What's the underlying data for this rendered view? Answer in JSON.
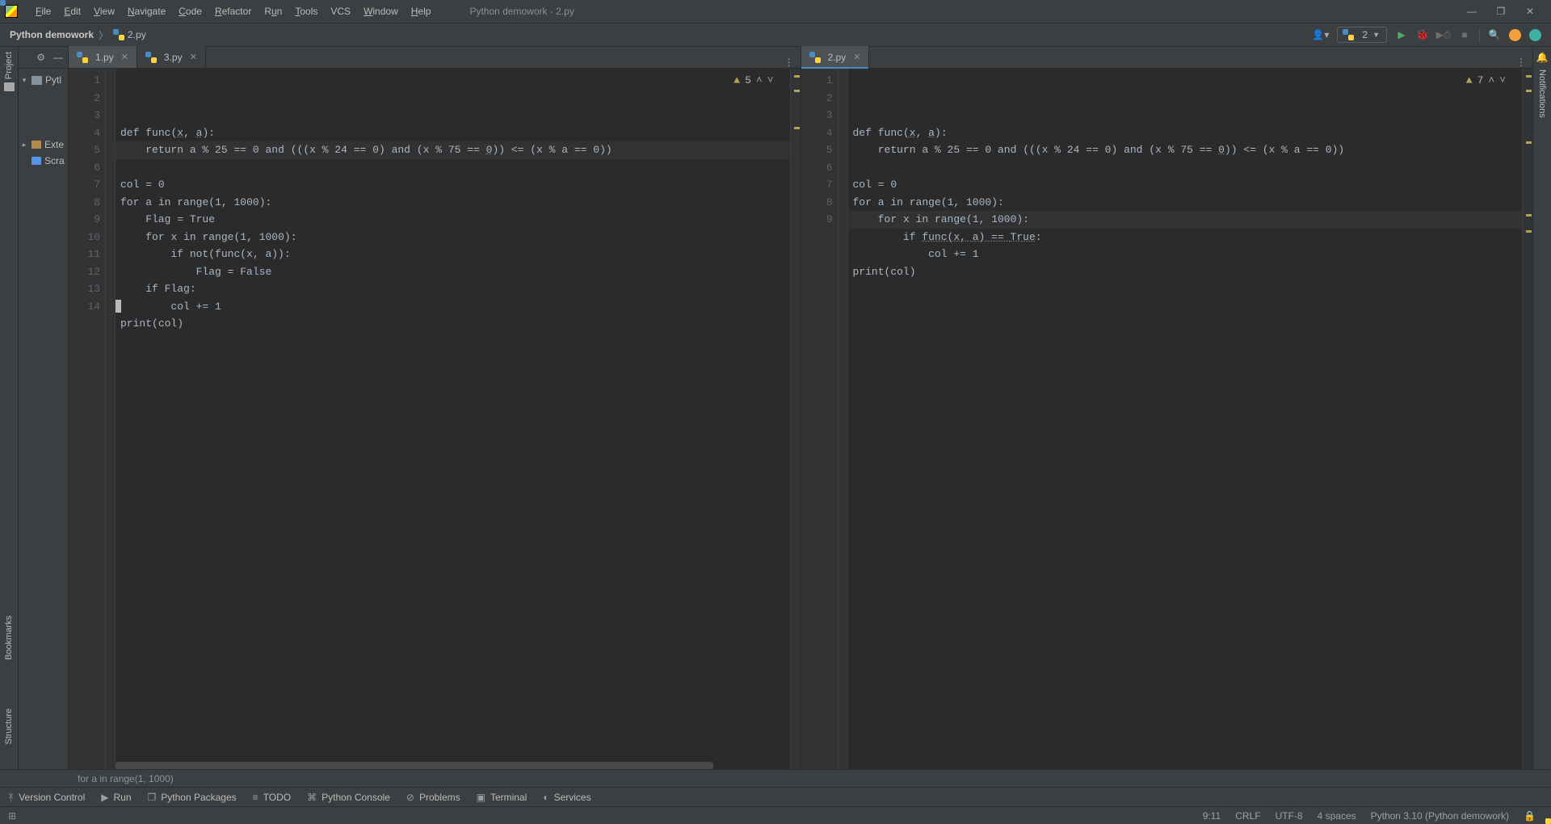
{
  "window": {
    "title": "Python demowork - 2.py"
  },
  "menu": {
    "file": "File",
    "edit": "Edit",
    "view": "View",
    "navigate": "Navigate",
    "code": "Code",
    "refactor": "Refactor",
    "run": "Run",
    "tools": "Tools",
    "vcs": "VCS",
    "window": "Window",
    "help": "Help"
  },
  "breadcrumb": {
    "project": "Python demowork",
    "file": "2.py"
  },
  "run_config": {
    "name": "2"
  },
  "project_tree": {
    "root": "Python demowork",
    "root_short": "Pytl",
    "external": "External Libraries",
    "external_short": "Exte",
    "scratches": "Scratches and Consoles",
    "scratches_short": "Scra"
  },
  "left_tabs": [
    {
      "label": "1.py",
      "active": true
    },
    {
      "label": "3.py",
      "active": false
    }
  ],
  "right_tabs": [
    {
      "label": "2.py",
      "active": true
    }
  ],
  "left_editor": {
    "warn_count": "5",
    "lines": 14,
    "code_html": "<span class='kw'>def </span><span class='fn'>func</span>(<span class='prm'>x</span>, <span class='prm'>a</span>):\n    <span class='kw'>return </span>a % <span class='num'>25</span> == <span class='num'>0</span> <span class='kw'>and </span>(((x % <span class='num'>24</span> == <span class='num'>0</span>) <span class='kw'>and </span>(x % <span class='num'>75</span> == <span class='prm'>0</span>)) &lt;= (x % a == <span class='num'>0</span>))\n\ncol = <span class='num'>0</span>\n<span class='kw'>for </span>a <span class='kw'>in </span><span class='bi'>range</span>(<span class='num'>1</span>, <span class='num'>1000</span>):\n    Flag = <span class='kw'>True</span>\n    <span class='kw'>for </span>x <span class='kw'>in </span><span class='bi'>range</span>(<span class='num'>1</span>, <span class='num'>1000</span>):\n        <span class='kw'>if not</span>(func(x, a)):\n            Flag = <span class='kw'>False</span>\n    <span class='kw'>if </span>Flag:\n        col += <span class='num'>1</span>\n<span class='bi'>print</span>(col)\n\n"
  },
  "right_editor": {
    "warn_count": "7",
    "lines": 9,
    "code_html": "<span class='kw'>def </span><span class='fn'>func</span>(<span class='prm'>x</span>, <span class='prm'>a</span>):\n    <span class='kw'>return </span>a % <span class='num'>25</span> == <span class='num'>0</span> <span class='kw'>and </span>(((x % <span class='num'>24</span> == <span class='num'>0</span>) <span class='kw'>and </span>(x % <span class='num'>75</span> == <span class='prm'>0</span>)) &lt;= (x % a == <span class='num'>0</span>))\n\ncol = <span class='num'>0</span>\n<span class='kw'>for </span>a <span class='kw'>in </span><span class='bi'>range</span>(<span class='num'>1</span>, <span class='num'>1000</span>):\n    <span class='kw'>for </span>x <span class='kw'>in </span><span class='bi'>range</span>(<span class='num'>1</span>, <span class='num'>1000</span>):\n        <span class='kw'>if </span><span style='text-decoration:underline dotted #777'>func(x, a) == <span class='kw'>True</span></span>:\n            col += <span class='num'>1</span>\n<span class='bi'>print</span><span>(</span>col<span>)</span>"
  },
  "crumb_context": "for a in range(1, 1000)",
  "sidebars": {
    "left": [
      "Project",
      "Bookmarks",
      "Structure"
    ],
    "right": "Notifications"
  },
  "bottom_tools": {
    "version_control": "Version Control",
    "run": "Run",
    "packages": "Python Packages",
    "todo": "TODO",
    "console": "Python Console",
    "problems": "Problems",
    "terminal": "Terminal",
    "services": "Services"
  },
  "status": {
    "pos": "9:11",
    "lineend": "CRLF",
    "encoding": "UTF-8",
    "indent": "4 spaces",
    "interpreter": "Python 3.10 (Python demowork)"
  }
}
